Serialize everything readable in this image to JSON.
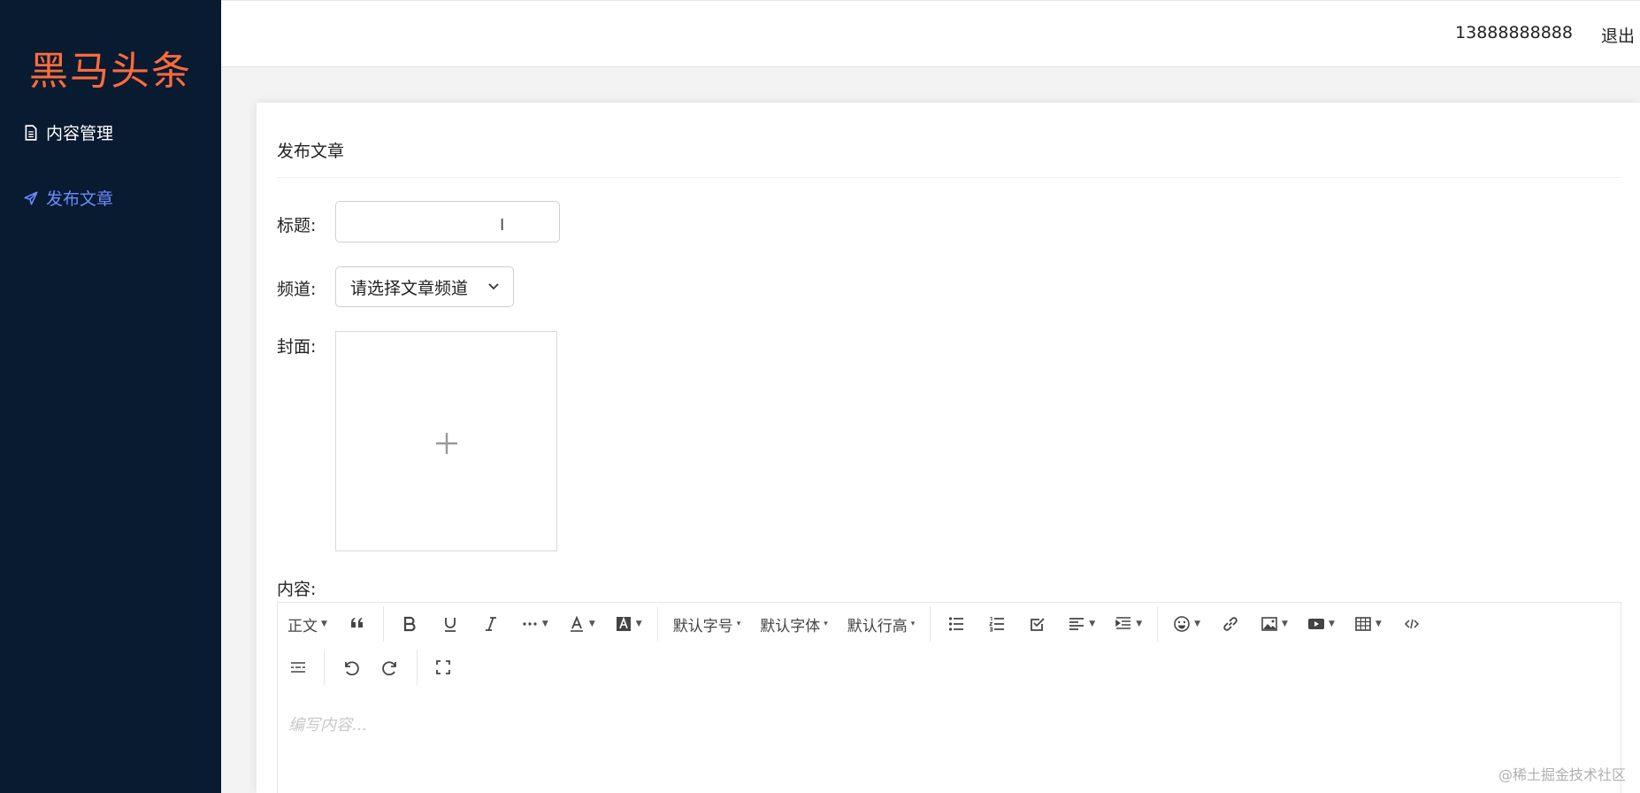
{
  "sidebar": {
    "logo": "黑马头条",
    "items": [
      {
        "label": "内容管理",
        "icon": "document-icon"
      },
      {
        "label": "发布文章",
        "icon": "send-icon"
      }
    ],
    "active_color": "#6c8cff",
    "background": "#081b30",
    "logo_color": "#ff6b3d"
  },
  "header": {
    "user": "13888888888",
    "logout": "退出"
  },
  "card": {
    "title": "发布文章"
  },
  "form": {
    "title_label": "标题:",
    "title_value": "",
    "channel_label": "频道:",
    "channel_value": "请选择文章频道",
    "cover_label": "封面:",
    "content_label": "内容:"
  },
  "editor": {
    "toolbar": {
      "paragraph": "正文",
      "font_size": "默认字号",
      "font_family": "默认字体",
      "line_height": "默认行高"
    },
    "placeholder": "编写内容..."
  },
  "watermark": "@稀土掘金技术社区"
}
